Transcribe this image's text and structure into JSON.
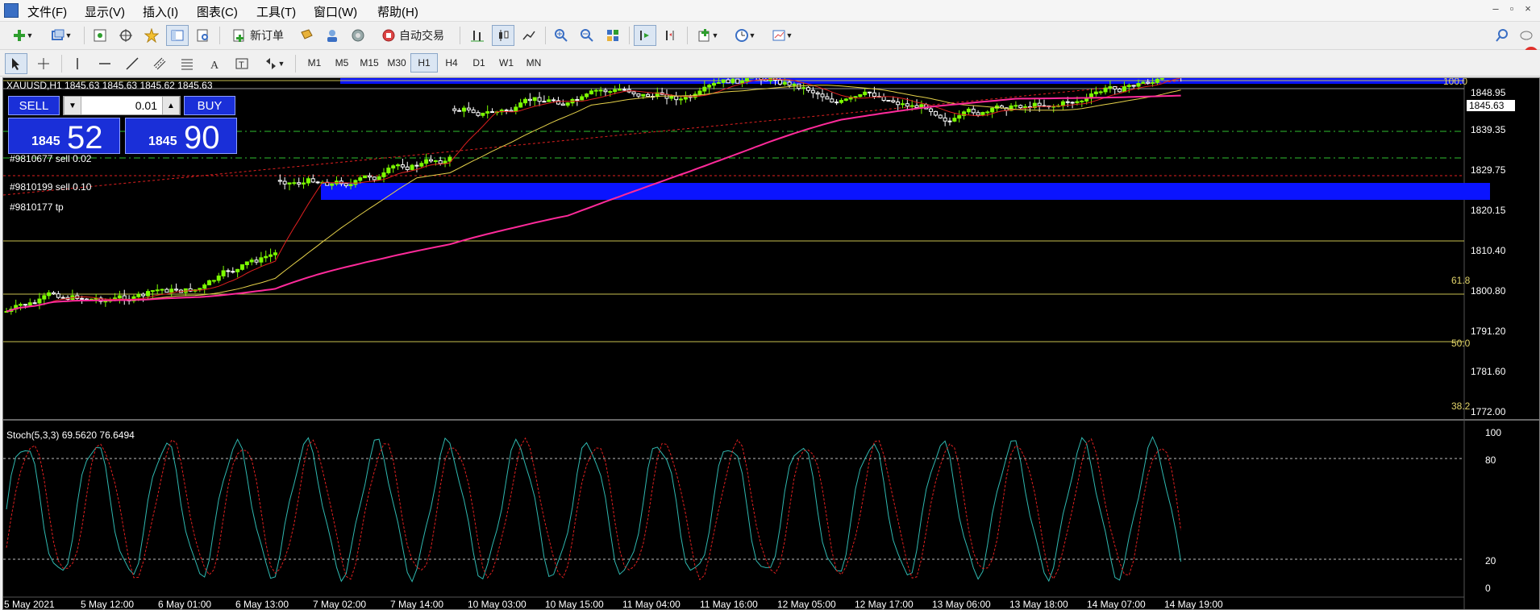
{
  "menu": [
    "文件(F)",
    "显示(V)",
    "插入(I)",
    "图表(C)",
    "工具(T)",
    "窗口(W)",
    "帮助(H)"
  ],
  "window_controls": [
    "–",
    "▫",
    "×"
  ],
  "toolbar": {
    "new_order": "新订单",
    "auto_trade": "自动交易",
    "notification_count": "1"
  },
  "timeframes": [
    "M1",
    "M5",
    "M15",
    "M30",
    "H1",
    "H4",
    "D1",
    "W1",
    "MN"
  ],
  "active_timeframe": "H1",
  "chart": {
    "title": "XAUUSD,H1  1845.63 1845.63 1845.62 1845.63",
    "current_price": "1845.63",
    "price_ticks": [
      "1848.95",
      "1839.35",
      "1829.75",
      "1820.15",
      "1810.40",
      "1800.80",
      "1791.20",
      "1781.60",
      "1772.00"
    ],
    "fib_levels": [
      "100.0",
      "61.8",
      "50.0",
      "38.2"
    ],
    "order_labels": [
      "#9810677 sell 0.02",
      "#9810199 sell 0.10",
      "#9810177 tp"
    ]
  },
  "trade_panel": {
    "sell_label": "SELL",
    "buy_label": "BUY",
    "lot": "0.01",
    "sell_small": "1845",
    "sell_big": "52",
    "buy_small": "1845",
    "buy_big": "90"
  },
  "stoch": {
    "label": "Stoch(5,3,3) 69.5620 76.6494",
    "ticks": [
      "100",
      "80",
      "20",
      "0"
    ]
  },
  "time_axis": [
    "5 May 2021",
    "5 May 12:00",
    "6 May 01:00",
    "6 May 13:00",
    "7 May 02:00",
    "7 May 14:00",
    "10 May 03:00",
    "10 May 15:00",
    "11 May 04:00",
    "11 May 16:00",
    "12 May 05:00",
    "12 May 17:00",
    "13 May 06:00",
    "13 May 18:00",
    "14 May 07:00",
    "14 May 19:00"
  ],
  "colors": {
    "bull": "#7cfc00",
    "bear": "#ffffff",
    "ma_fast": "#e02020",
    "ma_mid": "#e6d24a",
    "ma_slow": "#ff2a9a",
    "stoch_main": "#2fb8b0",
    "stoch_signal": "#e02020",
    "zone": "#0a14ff",
    "fib": "#c8c050"
  }
}
